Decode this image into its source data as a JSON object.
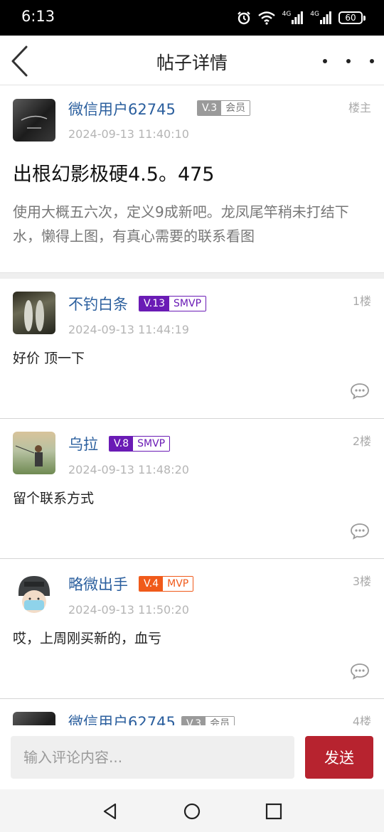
{
  "status_bar": {
    "time": "6:13",
    "network_1": "4G",
    "network_2": "4G",
    "battery": "60"
  },
  "header": {
    "title": "帖子详情",
    "back_icon": "chevron-left-icon",
    "more_icon": "more-dots-icon"
  },
  "post": {
    "author": "微信用户62745",
    "level": "V.3",
    "role": "会员",
    "floor": "楼主",
    "time": "2024-09-13 11:40:10",
    "title": "出根幻影极硬4.5。475",
    "body": "使用大概五六次，定义9成新吧。龙凤尾竿稍未打结下水，懒得上图，有真心需要的联系看图"
  },
  "comments": [
    {
      "author": "不钓白条",
      "level": "V.13",
      "role": "SMVP",
      "floor": "1楼",
      "time": "2024-09-13 11:44:19",
      "text": "好价 顶一下"
    },
    {
      "author": "乌拉",
      "level": "V.8",
      "role": "SMVP",
      "floor": "2楼",
      "time": "2024-09-13 11:48:20",
      "text": "留个联系方式"
    },
    {
      "author": "略微出手",
      "level": "V.4",
      "role": "MVP",
      "floor": "3楼",
      "time": "2024-09-13 11:50:20",
      "text": "哎，上周刚买新的，血亏"
    },
    {
      "author": "微信用户62745",
      "level": "V.3",
      "role": "会员",
      "floor": "4楼",
      "time": "",
      "text": ""
    }
  ],
  "input_bar": {
    "placeholder": "输入评论内容...",
    "send_label": "发送"
  },
  "colors": {
    "accent": "#b7232f",
    "name_blue": "#2b5f9e",
    "smvp_purple": "#6a1bb5",
    "mvp_orange": "#f05a1a",
    "member_gray": "#9a9a9a"
  }
}
